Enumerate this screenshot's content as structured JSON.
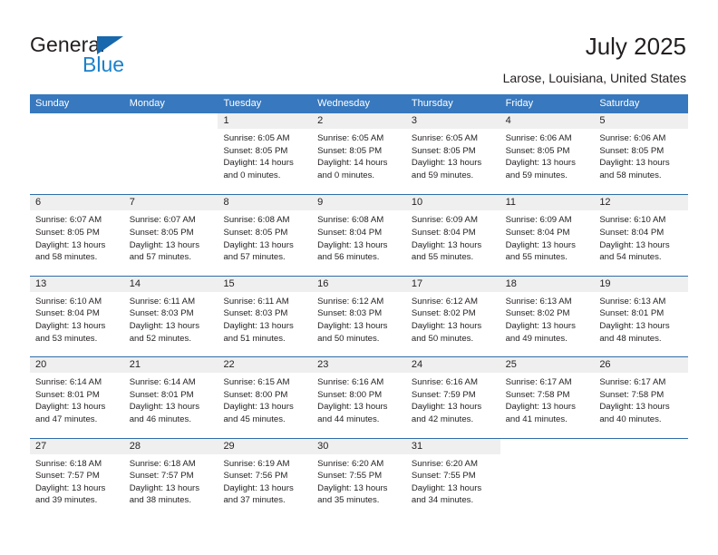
{
  "brand": {
    "name_part1": "General",
    "name_part2": "Blue",
    "triangle_color": "#1768ac",
    "blue_color": "#1b81cc"
  },
  "header": {
    "title": "July 2025",
    "location": "Larose, Louisiana, United States"
  },
  "theme": {
    "header_row_bg": "#3778be",
    "week_separator": "#2e6da8",
    "daynum_band_bg": "#efefef",
    "text_color": "#231f20"
  },
  "weekdays": [
    "Sunday",
    "Monday",
    "Tuesday",
    "Wednesday",
    "Thursday",
    "Friday",
    "Saturday"
  ],
  "labels": {
    "sunrise_prefix": "Sunrise: ",
    "sunset_prefix": "Sunset: ",
    "daylight_prefix": "Daylight: "
  },
  "weeks": [
    [
      {
        "empty": true
      },
      {
        "empty": true
      },
      {
        "day": "1",
        "line1": "Sunrise: 6:05 AM",
        "line2": "Sunset: 8:05 PM",
        "line3": "Daylight: 14 hours and 0 minutes."
      },
      {
        "day": "2",
        "line1": "Sunrise: 6:05 AM",
        "line2": "Sunset: 8:05 PM",
        "line3": "Daylight: 14 hours and 0 minutes."
      },
      {
        "day": "3",
        "line1": "Sunrise: 6:05 AM",
        "line2": "Sunset: 8:05 PM",
        "line3": "Daylight: 13 hours and 59 minutes."
      },
      {
        "day": "4",
        "line1": "Sunrise: 6:06 AM",
        "line2": "Sunset: 8:05 PM",
        "line3": "Daylight: 13 hours and 59 minutes."
      },
      {
        "day": "5",
        "line1": "Sunrise: 6:06 AM",
        "line2": "Sunset: 8:05 PM",
        "line3": "Daylight: 13 hours and 58 minutes."
      }
    ],
    [
      {
        "day": "6",
        "line1": "Sunrise: 6:07 AM",
        "line2": "Sunset: 8:05 PM",
        "line3": "Daylight: 13 hours and 58 minutes."
      },
      {
        "day": "7",
        "line1": "Sunrise: 6:07 AM",
        "line2": "Sunset: 8:05 PM",
        "line3": "Daylight: 13 hours and 57 minutes."
      },
      {
        "day": "8",
        "line1": "Sunrise: 6:08 AM",
        "line2": "Sunset: 8:05 PM",
        "line3": "Daylight: 13 hours and 57 minutes."
      },
      {
        "day": "9",
        "line1": "Sunrise: 6:08 AM",
        "line2": "Sunset: 8:04 PM",
        "line3": "Daylight: 13 hours and 56 minutes."
      },
      {
        "day": "10",
        "line1": "Sunrise: 6:09 AM",
        "line2": "Sunset: 8:04 PM",
        "line3": "Daylight: 13 hours and 55 minutes."
      },
      {
        "day": "11",
        "line1": "Sunrise: 6:09 AM",
        "line2": "Sunset: 8:04 PM",
        "line3": "Daylight: 13 hours and 55 minutes."
      },
      {
        "day": "12",
        "line1": "Sunrise: 6:10 AM",
        "line2": "Sunset: 8:04 PM",
        "line3": "Daylight: 13 hours and 54 minutes."
      }
    ],
    [
      {
        "day": "13",
        "line1": "Sunrise: 6:10 AM",
        "line2": "Sunset: 8:04 PM",
        "line3": "Daylight: 13 hours and 53 minutes."
      },
      {
        "day": "14",
        "line1": "Sunrise: 6:11 AM",
        "line2": "Sunset: 8:03 PM",
        "line3": "Daylight: 13 hours and 52 minutes."
      },
      {
        "day": "15",
        "line1": "Sunrise: 6:11 AM",
        "line2": "Sunset: 8:03 PM",
        "line3": "Daylight: 13 hours and 51 minutes."
      },
      {
        "day": "16",
        "line1": "Sunrise: 6:12 AM",
        "line2": "Sunset: 8:03 PM",
        "line3": "Daylight: 13 hours and 50 minutes."
      },
      {
        "day": "17",
        "line1": "Sunrise: 6:12 AM",
        "line2": "Sunset: 8:02 PM",
        "line3": "Daylight: 13 hours and 50 minutes."
      },
      {
        "day": "18",
        "line1": "Sunrise: 6:13 AM",
        "line2": "Sunset: 8:02 PM",
        "line3": "Daylight: 13 hours and 49 minutes."
      },
      {
        "day": "19",
        "line1": "Sunrise: 6:13 AM",
        "line2": "Sunset: 8:01 PM",
        "line3": "Daylight: 13 hours and 48 minutes."
      }
    ],
    [
      {
        "day": "20",
        "line1": "Sunrise: 6:14 AM",
        "line2": "Sunset: 8:01 PM",
        "line3": "Daylight: 13 hours and 47 minutes."
      },
      {
        "day": "21",
        "line1": "Sunrise: 6:14 AM",
        "line2": "Sunset: 8:01 PM",
        "line3": "Daylight: 13 hours and 46 minutes."
      },
      {
        "day": "22",
        "line1": "Sunrise: 6:15 AM",
        "line2": "Sunset: 8:00 PM",
        "line3": "Daylight: 13 hours and 45 minutes."
      },
      {
        "day": "23",
        "line1": "Sunrise: 6:16 AM",
        "line2": "Sunset: 8:00 PM",
        "line3": "Daylight: 13 hours and 44 minutes."
      },
      {
        "day": "24",
        "line1": "Sunrise: 6:16 AM",
        "line2": "Sunset: 7:59 PM",
        "line3": "Daylight: 13 hours and 42 minutes."
      },
      {
        "day": "25",
        "line1": "Sunrise: 6:17 AM",
        "line2": "Sunset: 7:58 PM",
        "line3": "Daylight: 13 hours and 41 minutes."
      },
      {
        "day": "26",
        "line1": "Sunrise: 6:17 AM",
        "line2": "Sunset: 7:58 PM",
        "line3": "Daylight: 13 hours and 40 minutes."
      }
    ],
    [
      {
        "day": "27",
        "line1": "Sunrise: 6:18 AM",
        "line2": "Sunset: 7:57 PM",
        "line3": "Daylight: 13 hours and 39 minutes."
      },
      {
        "day": "28",
        "line1": "Sunrise: 6:18 AM",
        "line2": "Sunset: 7:57 PM",
        "line3": "Daylight: 13 hours and 38 minutes."
      },
      {
        "day": "29",
        "line1": "Sunrise: 6:19 AM",
        "line2": "Sunset: 7:56 PM",
        "line3": "Daylight: 13 hours and 37 minutes."
      },
      {
        "day": "30",
        "line1": "Sunrise: 6:20 AM",
        "line2": "Sunset: 7:55 PM",
        "line3": "Daylight: 13 hours and 35 minutes."
      },
      {
        "day": "31",
        "line1": "Sunrise: 6:20 AM",
        "line2": "Sunset: 7:55 PM",
        "line3": "Daylight: 13 hours and 34 minutes."
      },
      {
        "empty": true
      },
      {
        "empty": true
      }
    ]
  ]
}
